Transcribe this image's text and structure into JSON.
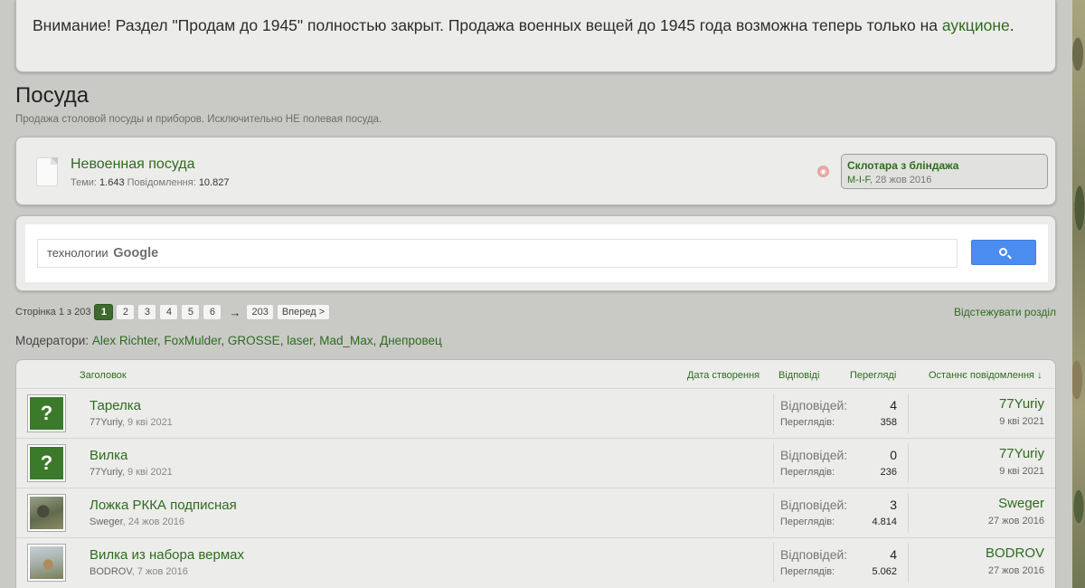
{
  "notice": {
    "text": "Внимание! Раздел \"Продам до 1945\" полностью закрыт. Продажа военных вещей до 1945 года возможна теперь только на",
    "link": "аукционе",
    "after": "."
  },
  "forum": {
    "title": "Посуда",
    "description": "Продажа столовой посуды и приборов. Исключительно НЕ полевая посуда."
  },
  "subforum": {
    "name": "Невоенная посуда",
    "threads_label": "Теми:",
    "threads_value": "1.643",
    "posts_label": "Повідомлення:",
    "posts_value": "10.827",
    "last_post_title": "Склотара з бліндажа",
    "last_post_user": "M-I-F",
    "last_post_date": "28 жов 2016"
  },
  "search": {
    "placeholder_prefix": "технологии",
    "placeholder_brand": "Google"
  },
  "pagination": {
    "label": "Сторінка 1 з 203",
    "pages": [
      "1",
      "2",
      "3",
      "4",
      "5",
      "6"
    ],
    "arrow": "→",
    "last": "203",
    "next": "Вперед >"
  },
  "watch_label": "Відстежувати розділ",
  "moderators": {
    "label": "Модератори:",
    "list": [
      "Alex Richter",
      "FoxMulder",
      "GROSSE",
      "laser",
      "Mad_Max",
      "Днепровец"
    ]
  },
  "table": {
    "headers": {
      "title": "Заголовок",
      "created": "Дата створення",
      "replies": "Відповіді",
      "views": "Перегляді",
      "last": "Останнє повідомлення ↓"
    },
    "replies_label": "Відповідей:",
    "views_label": "Переглядів:",
    "rows": [
      {
        "title": "Тарелка",
        "author": "77Yuriy",
        "date": "9 кві 2021",
        "replies": "4",
        "views": "358",
        "last_user": "77Yuriy",
        "last_date": "9 кві 2021",
        "avatar": "question"
      },
      {
        "title": "Вилка",
        "author": "77Yuriy",
        "date": "9 кві 2021",
        "replies": "0",
        "views": "236",
        "last_user": "77Yuriy",
        "last_date": "9 кві 2021",
        "avatar": "question"
      },
      {
        "title": "Ложка РККА подписная",
        "author": "Sweger",
        "date": "24 жов 2016",
        "replies": "3",
        "views": "4.814",
        "last_user": "Sweger",
        "last_date": "27 жов 2016",
        "avatar": "photo1"
      },
      {
        "title": "Вилка из набора вермах",
        "author": "BODROV",
        "date": "7 жов 2016",
        "replies": "4",
        "views": "5.062",
        "last_user": "BODROV",
        "last_date": "27 жов 2016",
        "avatar": "photo2"
      }
    ]
  },
  "colors": {
    "link": "#2f6b1f",
    "page_current": "#3c6b2c",
    "search_button": "#4b8cf0",
    "background": "#c9cac6"
  }
}
